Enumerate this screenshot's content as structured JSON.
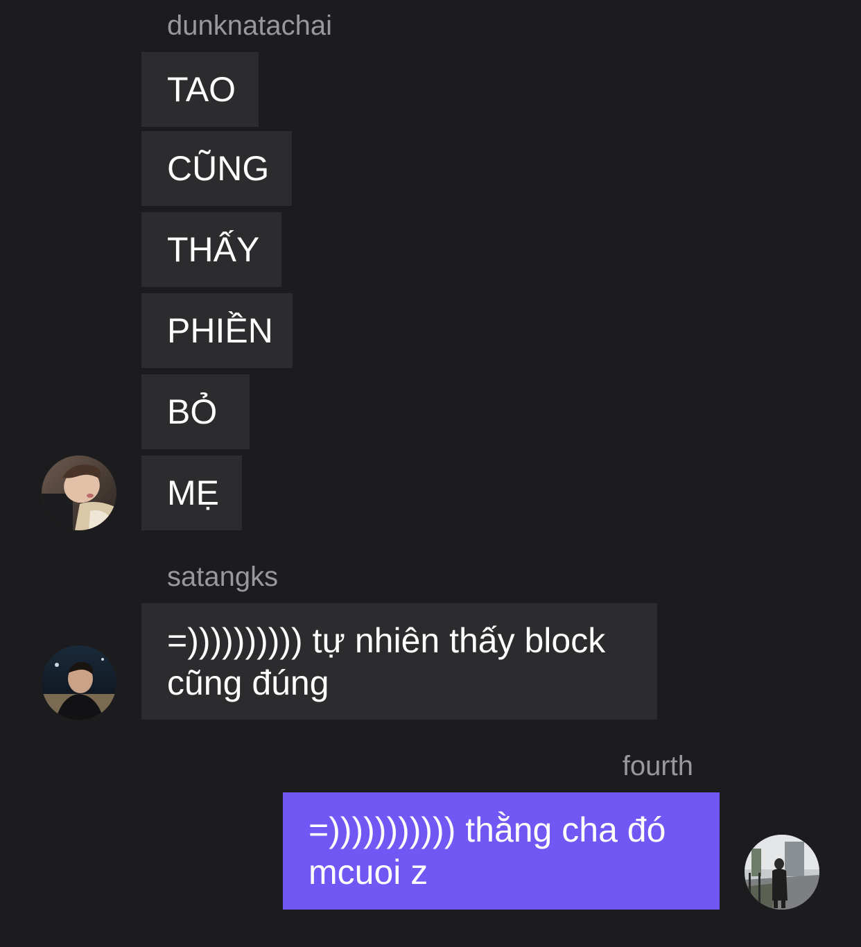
{
  "groups": [
    {
      "sender": "dunknatachai",
      "messages": [
        "TAO",
        "CŨNG",
        "THẤY",
        "PHIỀN",
        "BỎ",
        "MẸ"
      ]
    },
    {
      "sender": "satangks",
      "messages": [
        "=)))))))))) tự nhiên thấy block cũng đúng"
      ]
    },
    {
      "sender": "fourth",
      "messages": [
        "=))))))))))) thằng cha đó mcuoi z"
      ]
    }
  ],
  "avatars": {
    "dunknatachai": "avatar-photo-person-blond",
    "satangks": "avatar-photo-person-dark",
    "fourth": "avatar-photo-street"
  },
  "colors": {
    "background": "#1c1c1e",
    "incoming_bubble": "#2c2c2e",
    "outgoing_bubble": "#7158f5",
    "sender_name": "#98989f",
    "message_text": "#ffffff"
  }
}
